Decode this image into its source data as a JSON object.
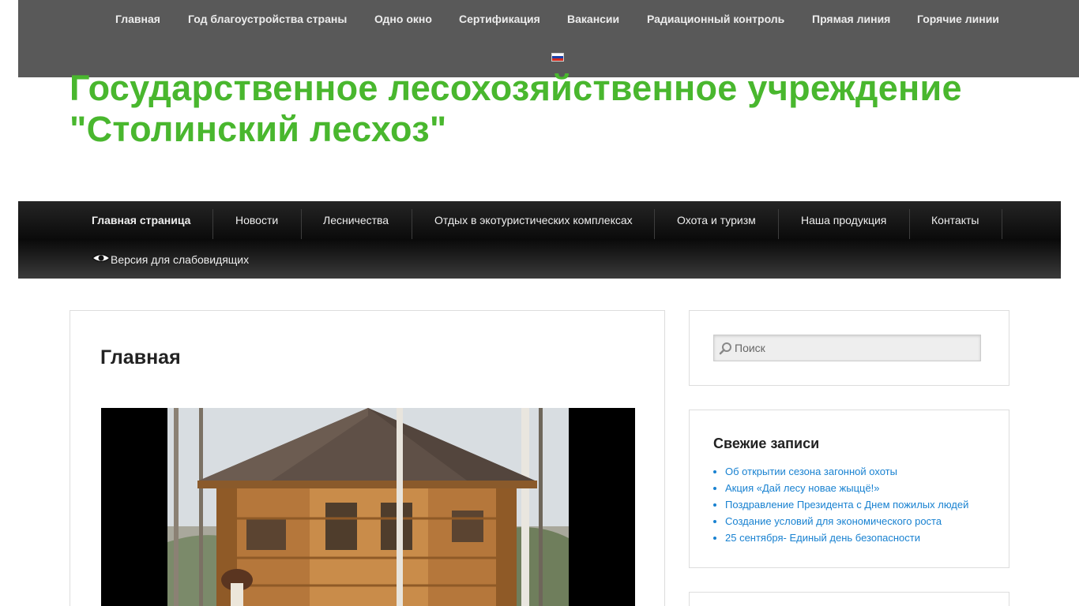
{
  "top_menu": {
    "items": [
      "Главная",
      "Год благоустройства страны",
      "Одно окно",
      "Сертификация",
      "Вакансии",
      "Радиационный контроль",
      "Прямая линия",
      "Горячие линии"
    ]
  },
  "language": {
    "flag_icon": "russian-flag-icon"
  },
  "site": {
    "title_line1": "Государственное лесохозяйственное учреждение",
    "title_line2": "\"Столинский лесхоз\"",
    "title_color": "#49b72e"
  },
  "main_menu": {
    "items": [
      "Главная страница",
      "Новости",
      "Лесничества",
      "Отдых в экотуристических комплексах",
      "Охота и туризм",
      "Наша продукция",
      "Контакты"
    ],
    "current": "Главная страница",
    "low_vision_label": "Версия для слабовидящих",
    "low_vision_icon": "eye-icon"
  },
  "article": {
    "title": "Главная",
    "image_icon": "gazebo-photo"
  },
  "sidebar": {
    "search": {
      "placeholder": "Поиск",
      "icon": "search-icon"
    },
    "recent_posts": {
      "title": "Свежие записи",
      "items": [
        "Об открытии сезона загонной охоты",
        "Акция «Дай лесу новае жыццё!»",
        "Поздравление Президента с Днем пожилых людей",
        "Создание условий для экономического роста",
        "25 сентября- Единый день безопасности"
      ]
    }
  },
  "colors": {
    "topbar_bg": "#595959",
    "link": "#1982d1",
    "nav_bg": "#1a1a1a"
  }
}
